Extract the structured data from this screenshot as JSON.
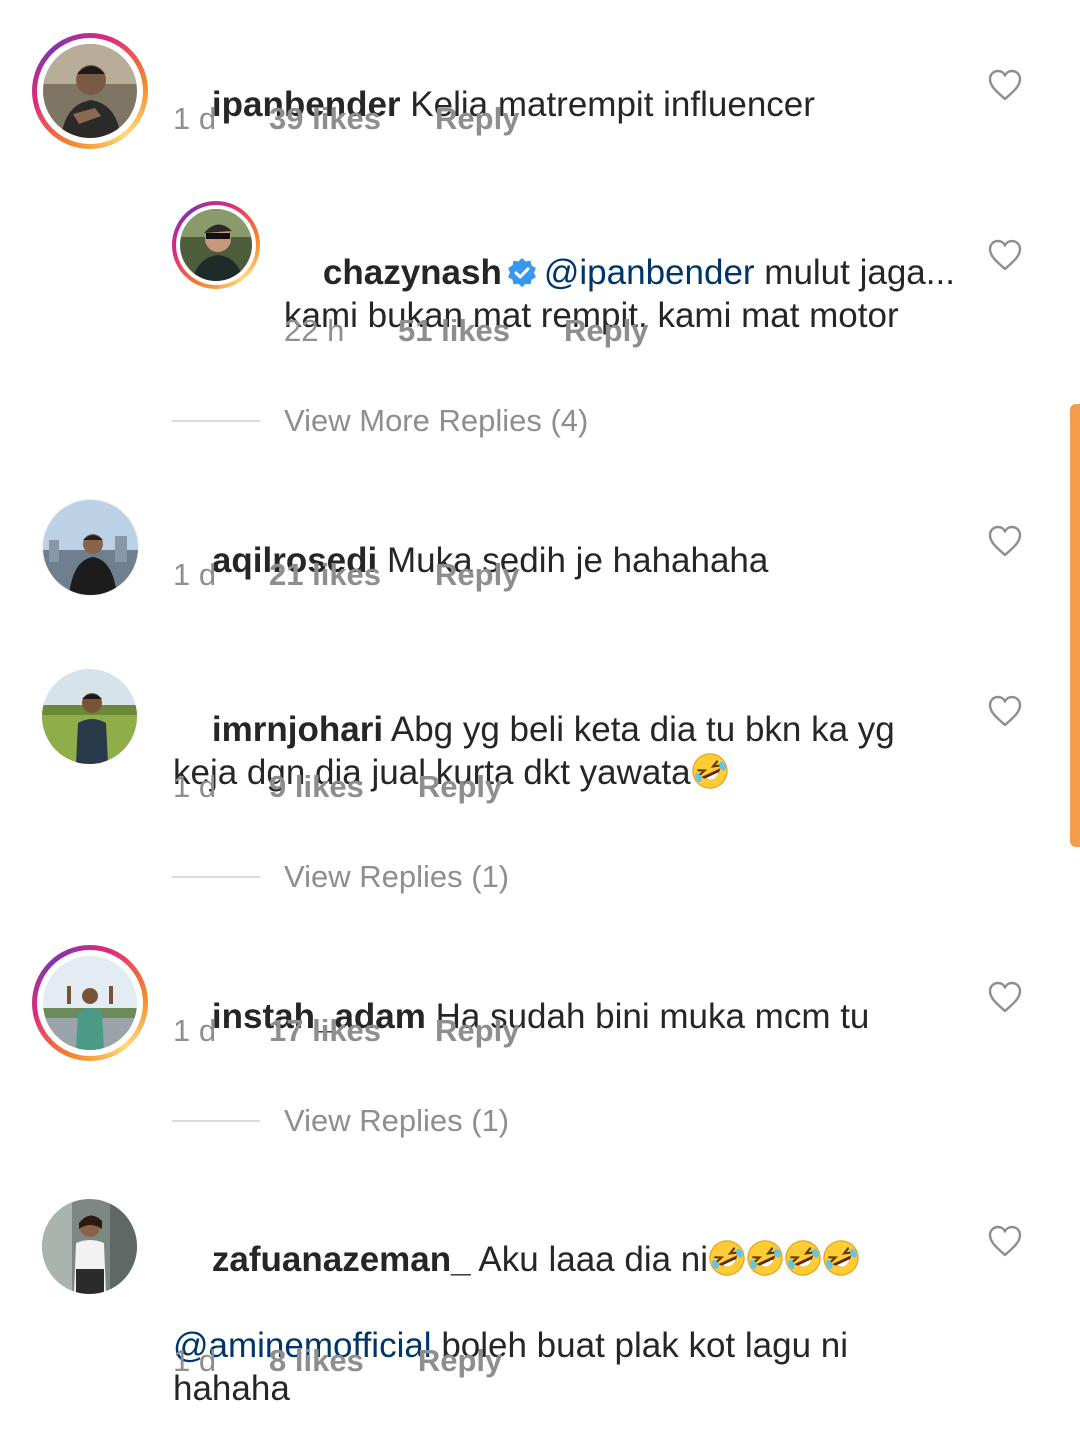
{
  "comments": [
    {
      "username": "ipanbender",
      "text": "Kelia matrempit influencer",
      "time": "1 d",
      "likes": "39 likes",
      "reply": "Reply"
    },
    {
      "username": "chazynash",
      "mention": "@ipanbender",
      "text": " mulut jaga... kami bukan mat rempit. kami mat motor",
      "time": "22 h",
      "likes": "51 likes",
      "reply": "Reply"
    },
    {
      "username": "aqilrosedi",
      "text": "Muka sedih je hahahaha",
      "time": "1 d",
      "likes": "21 likes",
      "reply": "Reply"
    },
    {
      "username": "imrnjohari",
      "text": "Abg yg beli keta dia tu bkn ka yg keja dgn dia jual kurta dkt yawata",
      "time": "1 d",
      "likes": "9 likes",
      "reply": "Reply"
    },
    {
      "username": "instah_adam",
      "text": "Ha sudah bini muka mcm tu",
      "time": "1 d",
      "likes": "17 likes",
      "reply": "Reply"
    },
    {
      "username": "zafuanazeman_",
      "text": "Aku laaa dia ni",
      "mention": "@aminemofficial",
      "text2": " boleh buat plak kot lagu ni hahaha",
      "time": "1 d",
      "likes": "8 likes",
      "reply": "Reply"
    }
  ],
  "view_replies": [
    "View More Replies (4)",
    "View Replies (1)",
    "View Replies (1)"
  ],
  "icons": {
    "heart": "heart-outline-icon",
    "verified": "verified-badge-icon",
    "emoji": "rolling-on-floor-laughing-emoji"
  },
  "colors": {
    "username": "#262626",
    "meta": "#8e8e8e",
    "mention": "#003569",
    "verified": "#3897f0",
    "scrollbar": "#f39c4a"
  }
}
